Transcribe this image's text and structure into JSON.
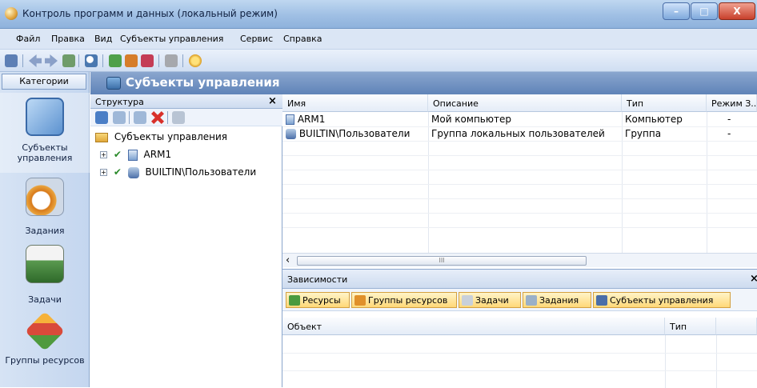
{
  "window": {
    "title": "Контроль программ и данных (локальный режим)",
    "minimize": "–",
    "maximize": "□",
    "close": "X"
  },
  "menu": [
    "Файл",
    "Правка",
    "Вид",
    "Субъекты управления",
    "Сервис",
    "Справка"
  ],
  "categories": {
    "header": "Категории",
    "items": [
      {
        "label": "Субъекты управления",
        "icon": "users-computer-icon"
      },
      {
        "label": "Задания",
        "icon": "clock-clipboard-icon"
      },
      {
        "label": "Задачи",
        "icon": "printer-task-icon"
      },
      {
        "label": "Группы ресурсов",
        "icon": "cubes-icon"
      }
    ]
  },
  "banner": {
    "title": "Субъекты управления"
  },
  "tree": {
    "header": "Структура",
    "close": "×",
    "root": "Субъекты управления",
    "nodes": [
      "ARM1",
      "BUILTIN\\Пользователи"
    ],
    "check": "✔",
    "expander": "+"
  },
  "grid": {
    "columns": [
      "Имя",
      "Описание",
      "Тип",
      "Режим З..."
    ],
    "rows": [
      {
        "name": "ARM1",
        "description": "Мой компьютер",
        "type": "Компьютер",
        "mode": "-"
      },
      {
        "name": "BUILTIN\\Пользователи",
        "description": "Группа локальных пользователей",
        "type": "Группа",
        "mode": "-"
      }
    ],
    "scroll_left": "‹",
    "scroll_grip": "III"
  },
  "dependencies": {
    "header": "Зависимости",
    "close": "×",
    "tabs": [
      "Ресурсы",
      "Группы ресурсов",
      "Задачи",
      "Задания",
      "Субъекты управления"
    ],
    "columns": [
      "Объект",
      "Тип"
    ]
  },
  "colors": {
    "accent": "#5f83b8",
    "tab_active": "#ffd878",
    "background": "#dbe6f5"
  }
}
